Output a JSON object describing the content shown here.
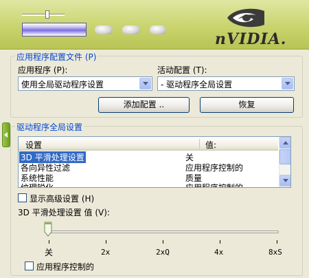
{
  "brand": {
    "logo_text": "nVIDIA."
  },
  "app_profile": {
    "group_title": "应用程序配置文件 (P)",
    "application_label": "应用程序 (P):",
    "application_value": "使用全局驱动程序设置",
    "active_profile_label": "活动配置 (T):",
    "active_profile_value": "- 驱动程序全局设置",
    "add_profile_button": "添加配置 ..",
    "restore_button": "恢复"
  },
  "global_settings": {
    "group_title": "驱动程序全局设置",
    "columns": {
      "setting": "设置",
      "value": "值:"
    },
    "rows": [
      {
        "setting": "3D 平滑处理设置",
        "value": "关",
        "selected": true
      },
      {
        "setting": "各向异性过滤",
        "value": "应用程序控制的",
        "selected": false
      },
      {
        "setting": "系统性能",
        "value": "质量",
        "selected": false
      },
      {
        "setting": "纹理锐化",
        "value": "应用程序控制的",
        "selected": false
      }
    ],
    "show_advanced_label": "显示高级设置 (H)",
    "value_label": "3D 平滑处理设置 值 (V):",
    "slider_ticks": [
      "关",
      "2x",
      "2xQ",
      "4x",
      "8xS"
    ],
    "slider_value_index": 0,
    "app_controlled_label": "应用程序控制的"
  },
  "colors": {
    "accent": "#0046d5",
    "selection": "#316ac5",
    "banner": "#c9d46d"
  }
}
